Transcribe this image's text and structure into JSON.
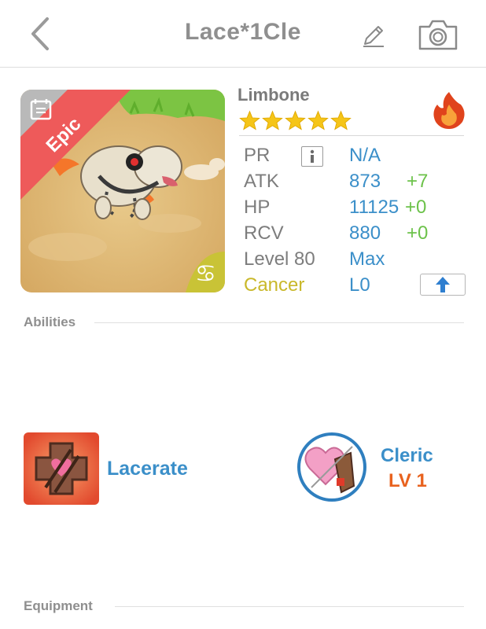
{
  "header": {
    "title": "Lace*1Cle",
    "back_icon": "back-chevron-icon",
    "edit_icon": "pencil-icon",
    "camera_icon": "camera-icon"
  },
  "monster": {
    "rarity": "Epic",
    "name": "Limbone",
    "stars": 5,
    "element_icon": "fire-icon",
    "sign_icon": "cancer-zodiac-icon"
  },
  "stats": {
    "pr": {
      "label": "PR",
      "value": "N/A"
    },
    "atk": {
      "label": "ATK",
      "value": "873",
      "bonus": "+7"
    },
    "hp": {
      "label": "HP",
      "value": "11125",
      "bonus": "+0"
    },
    "rcv": {
      "label": "RCV",
      "value": "880",
      "bonus": "+0"
    },
    "level": {
      "label": "Level 80",
      "value": "Max"
    },
    "sign": {
      "label": "Cancer",
      "value": "L0"
    }
  },
  "sections": {
    "abilities": "Abilities",
    "equipment": "Equipment"
  },
  "abilities": {
    "ability_name": "Lacerate",
    "class_name": "Cleric",
    "class_level": "LV 1"
  },
  "colors": {
    "accent_blue": "#3b8fc9",
    "bonus_green": "#6cc24a",
    "cancer_yellow": "#c9b82a",
    "level_orange": "#e8621e",
    "epic_red": "#ee5a5a"
  }
}
